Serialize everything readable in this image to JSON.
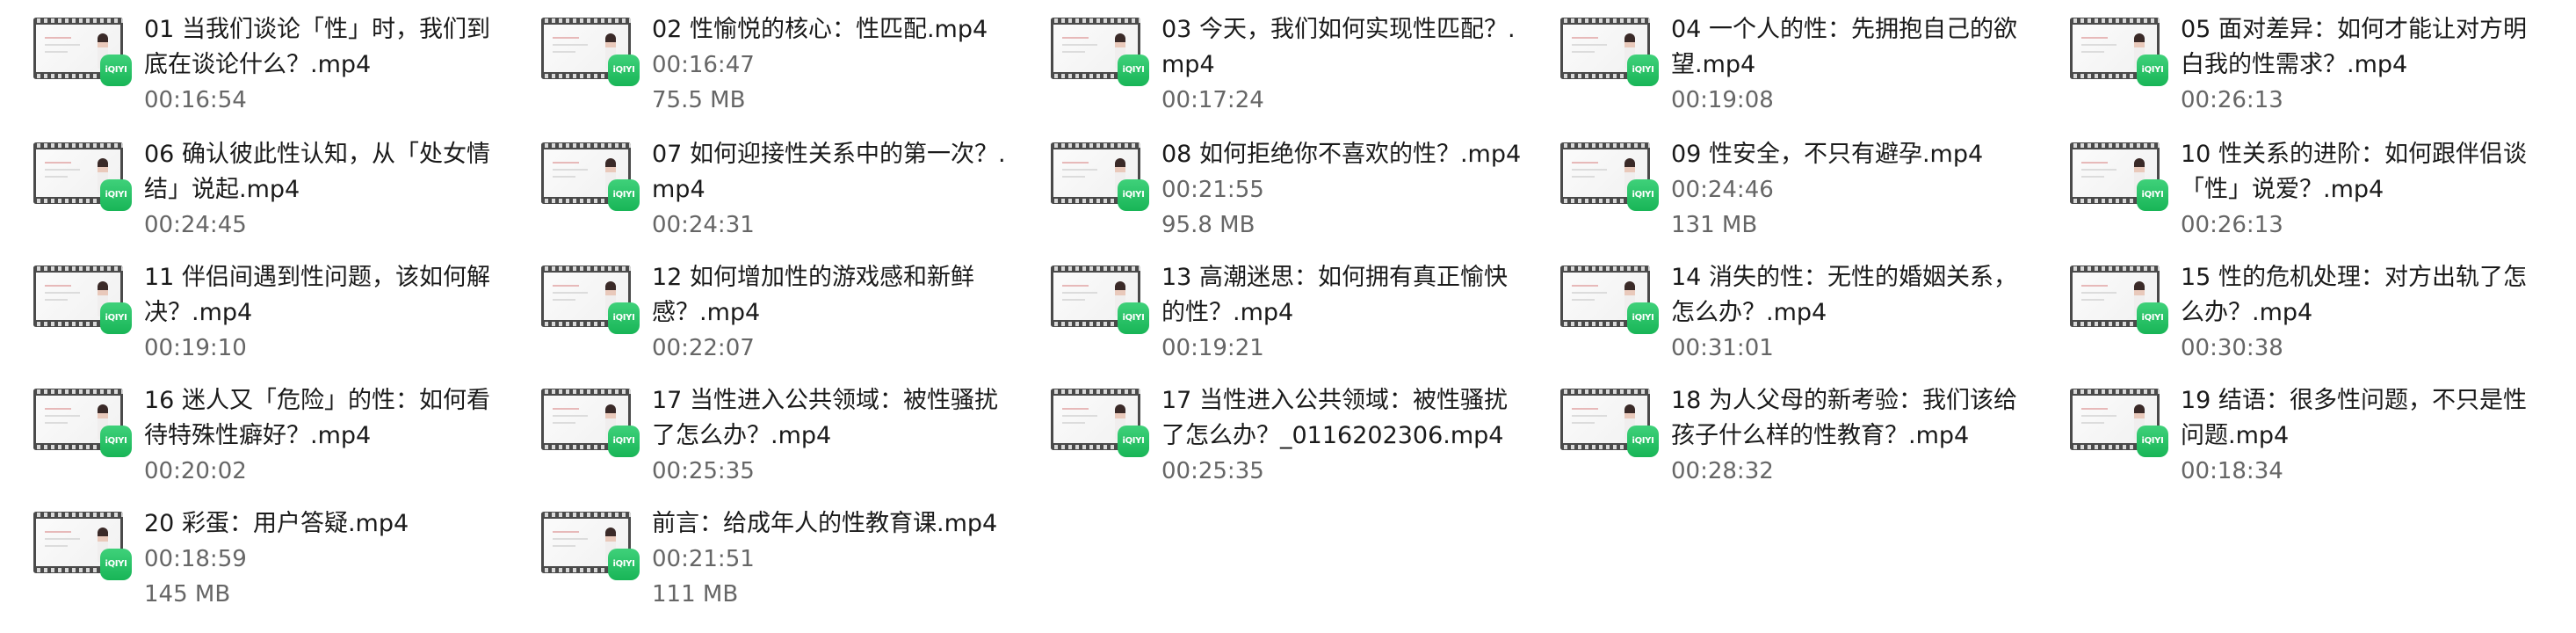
{
  "badge_text": "iQIYI",
  "files": [
    {
      "name": "01 当我们谈论「性」时，我们到底在谈论什么？.mp4",
      "duration": "00:16:54",
      "size": ""
    },
    {
      "name": "02 性愉悦的核心：性匹配.mp4",
      "duration": "00:16:47",
      "size": "75.5 MB"
    },
    {
      "name": "03 今天，我们如何实现性匹配？.mp4",
      "duration": "00:17:24",
      "size": ""
    },
    {
      "name": "04 一个人的性：先拥抱自己的欲望.mp4",
      "duration": "00:19:08",
      "size": ""
    },
    {
      "name": "05 面对差异：如何才能让对方明白我的性需求？.mp4",
      "duration": "00:26:13",
      "size": ""
    },
    {
      "name": "06 确认彼此性认知，从「处女情结」说起.mp4",
      "duration": "00:24:45",
      "size": ""
    },
    {
      "name": "07 如何迎接性关系中的第一次？.mp4",
      "duration": "00:24:31",
      "size": ""
    },
    {
      "name": "08 如何拒绝你不喜欢的性？.mp4",
      "duration": "00:21:55",
      "size": "95.8 MB"
    },
    {
      "name": "09 性安全，不只有避孕.mp4",
      "duration": "00:24:46",
      "size": "131 MB"
    },
    {
      "name": "10 性关系的进阶：如何跟伴侣谈「性」说爱？.mp4",
      "duration": "00:26:13",
      "size": ""
    },
    {
      "name": "11 伴侣间遇到性问题，该如何解决？.mp4",
      "duration": "00:19:10",
      "size": ""
    },
    {
      "name": "12 如何增加性的游戏感和新鲜感？.mp4",
      "duration": "00:22:07",
      "size": ""
    },
    {
      "name": "13 高潮迷思：如何拥有真正愉快的性？.mp4",
      "duration": "00:19:21",
      "size": ""
    },
    {
      "name": "14 消失的性：无性的婚姻关系，怎么办？.mp4",
      "duration": "00:31:01",
      "size": ""
    },
    {
      "name": "15 性的危机处理：对方出轨了怎么办？.mp4",
      "duration": "00:30:38",
      "size": ""
    },
    {
      "name": "16 迷人又「危险」的性：如何看待特殊性癖好？.mp4",
      "duration": "00:20:02",
      "size": ""
    },
    {
      "name": "17 当性进入公共领域：被性骚扰了怎么办？.mp4",
      "duration": "00:25:35",
      "size": ""
    },
    {
      "name": "17 当性进入公共领域：被性骚扰了怎么办？_0116202306.mp4",
      "duration": "00:25:35",
      "size": ""
    },
    {
      "name": "18 为人父母的新考验：我们该给孩子什么样的性教育？.mp4",
      "duration": "00:28:32",
      "size": ""
    },
    {
      "name": "19 结语：很多性问题，不只是性问题.mp4",
      "duration": "00:18:34",
      "size": ""
    },
    {
      "name": "20 彩蛋：用户答疑.mp4",
      "duration": "00:18:59",
      "size": "145 MB"
    },
    {
      "name": "前言：给成年人的性教育课.mp4",
      "duration": "00:21:51",
      "size": "111 MB"
    }
  ]
}
